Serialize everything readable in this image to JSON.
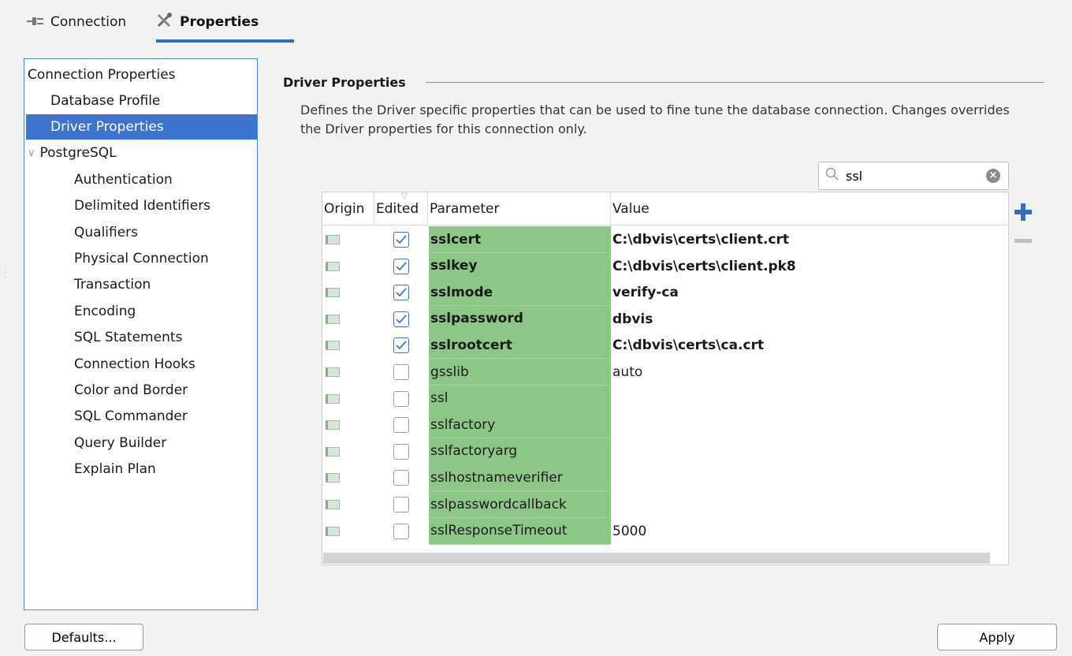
{
  "tabs": [
    {
      "label": "Connection",
      "icon": "plug-icon",
      "active": false
    },
    {
      "label": "Properties",
      "icon": "tools-icon",
      "active": true
    }
  ],
  "nav": {
    "items": [
      {
        "label": "Connection Properties",
        "level": 0
      },
      {
        "label": "Database Profile",
        "level": 1
      },
      {
        "label": "Driver Properties",
        "level": 1,
        "selected": true
      },
      {
        "label": "PostgreSQL",
        "level": 0,
        "expanded": true
      },
      {
        "label": "Authentication",
        "level": 2
      },
      {
        "label": "Delimited Identifiers",
        "level": 2
      },
      {
        "label": "Qualifiers",
        "level": 2
      },
      {
        "label": "Physical Connection",
        "level": 2
      },
      {
        "label": "Transaction",
        "level": 2
      },
      {
        "label": "Encoding",
        "level": 2
      },
      {
        "label": "SQL Statements",
        "level": 2
      },
      {
        "label": "Connection Hooks",
        "level": 2
      },
      {
        "label": "Color and Border",
        "level": 2
      },
      {
        "label": "SQL Commander",
        "level": 2
      },
      {
        "label": "Query Builder",
        "level": 2
      },
      {
        "label": "Explain Plan",
        "level": 2
      }
    ]
  },
  "section": {
    "title": "Driver Properties",
    "description": "Defines the Driver specific properties that can be used to fine tune the database connection. Changes overrides the Driver properties for this connection only."
  },
  "search": {
    "value": "ssl",
    "placeholder": ""
  },
  "table": {
    "headers": {
      "origin": "Origin",
      "edited": "Edited",
      "parameter": "Parameter",
      "value": "Value"
    },
    "rows": [
      {
        "edited": true,
        "parameter": "sslcert",
        "value": "C:\\dbvis\\certs\\client.crt"
      },
      {
        "edited": true,
        "parameter": "sslkey",
        "value": "C:\\dbvis\\certs\\client.pk8"
      },
      {
        "edited": true,
        "parameter": "sslmode",
        "value": "verify-ca"
      },
      {
        "edited": true,
        "parameter": "sslpassword",
        "value": "dbvis"
      },
      {
        "edited": true,
        "parameter": "sslrootcert",
        "value": "C:\\dbvis\\certs\\ca.crt"
      },
      {
        "edited": false,
        "parameter": "gsslib",
        "value": "auto"
      },
      {
        "edited": false,
        "parameter": "ssl",
        "value": ""
      },
      {
        "edited": false,
        "parameter": "sslfactory",
        "value": ""
      },
      {
        "edited": false,
        "parameter": "sslfactoryarg",
        "value": ""
      },
      {
        "edited": false,
        "parameter": "sslhostnameverifier",
        "value": ""
      },
      {
        "edited": false,
        "parameter": "sslpasswordcallback",
        "value": ""
      },
      {
        "edited": false,
        "parameter": "sslResponseTimeout",
        "value": "5000"
      }
    ]
  },
  "buttons": {
    "defaults": "Defaults...",
    "apply": "Apply"
  },
  "colors": {
    "accent": "#3d74d0",
    "parameter_bg": "#8cc788",
    "tab_underline": "#2f6fbf"
  }
}
